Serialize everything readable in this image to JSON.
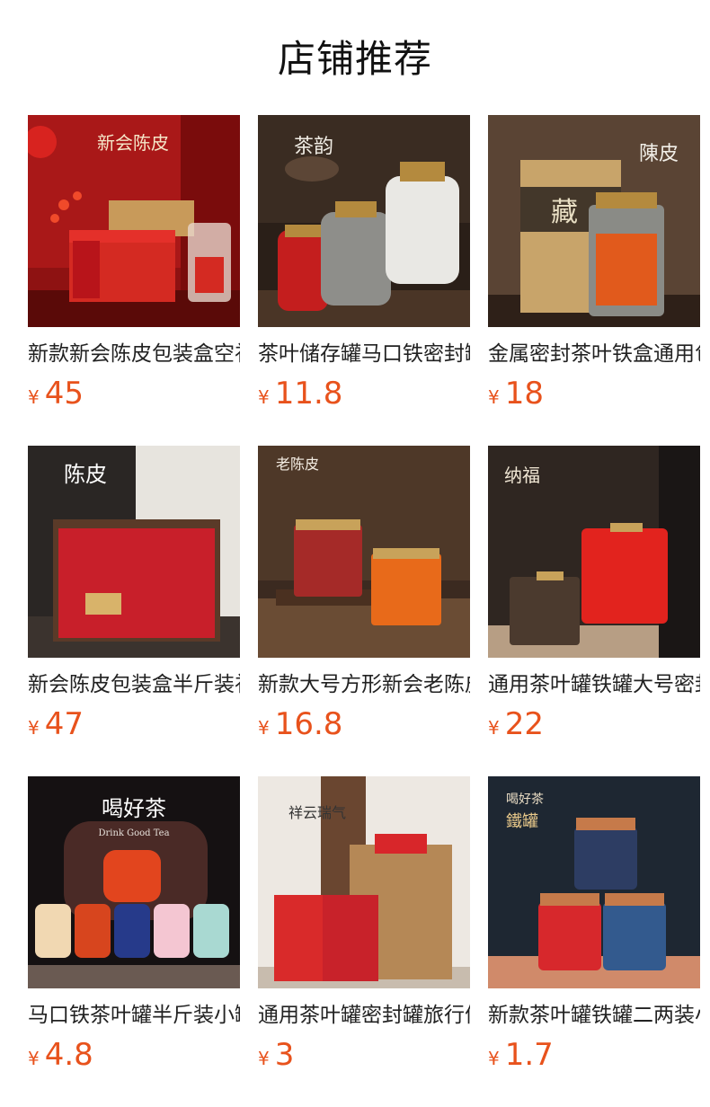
{
  "page": {
    "title": "店铺推荐"
  },
  "colors": {
    "price": "#e8521c",
    "title": "#111111"
  },
  "products": [
    {
      "name": "新款新会陈皮包装盒空礼盒",
      "currency": "¥",
      "price": "45",
      "image": "tangerine-peel-gift-box-red"
    },
    {
      "name": "茶叶储存罐马口铁密封罐",
      "currency": "¥",
      "price": "11.8",
      "image": "tin-tea-canisters-trio"
    },
    {
      "name": "金属密封茶叶铁盒通用包装",
      "currency": "¥",
      "price": "18",
      "image": "kraft-bag-and-square-tin"
    },
    {
      "name": "新会陈皮包装盒半斤装礼盒",
      "currency": "¥",
      "price": "47",
      "image": "red-gift-box-chenpi"
    },
    {
      "name": "新款大号方形新会老陈皮罐",
      "currency": "¥",
      "price": "16.8",
      "image": "two-square-tins"
    },
    {
      "name": "通用茶叶罐铁罐大号密封罐",
      "currency": "¥",
      "price": "22",
      "image": "red-square-tin-nafu"
    },
    {
      "name": "马口铁茶叶罐半斤装小罐",
      "currency": "¥",
      "price": "4.8",
      "image": "drink-good-tea-tins"
    },
    {
      "name": "通用茶叶罐密封罐旅行便携",
      "currency": "¥",
      "price": "3",
      "image": "red-tins-with-kraft-bag"
    },
    {
      "name": "新款茶叶罐铁罐二两装小号",
      "currency": "¥",
      "price": "1.7",
      "image": "stacked-round-canisters"
    }
  ],
  "image_text": {
    "p1": "新会陈皮",
    "p2": "茶韵",
    "p3a": "陳皮",
    "p3b": "藏",
    "p4": "陈皮",
    "p5": "老陈皮",
    "p6": "纳福",
    "p7a": "喝好茶",
    "p7b": "Drink Good Tea",
    "p8": "祥云瑞气",
    "p9a": "喝好茶",
    "p9b": "鐵罐"
  }
}
